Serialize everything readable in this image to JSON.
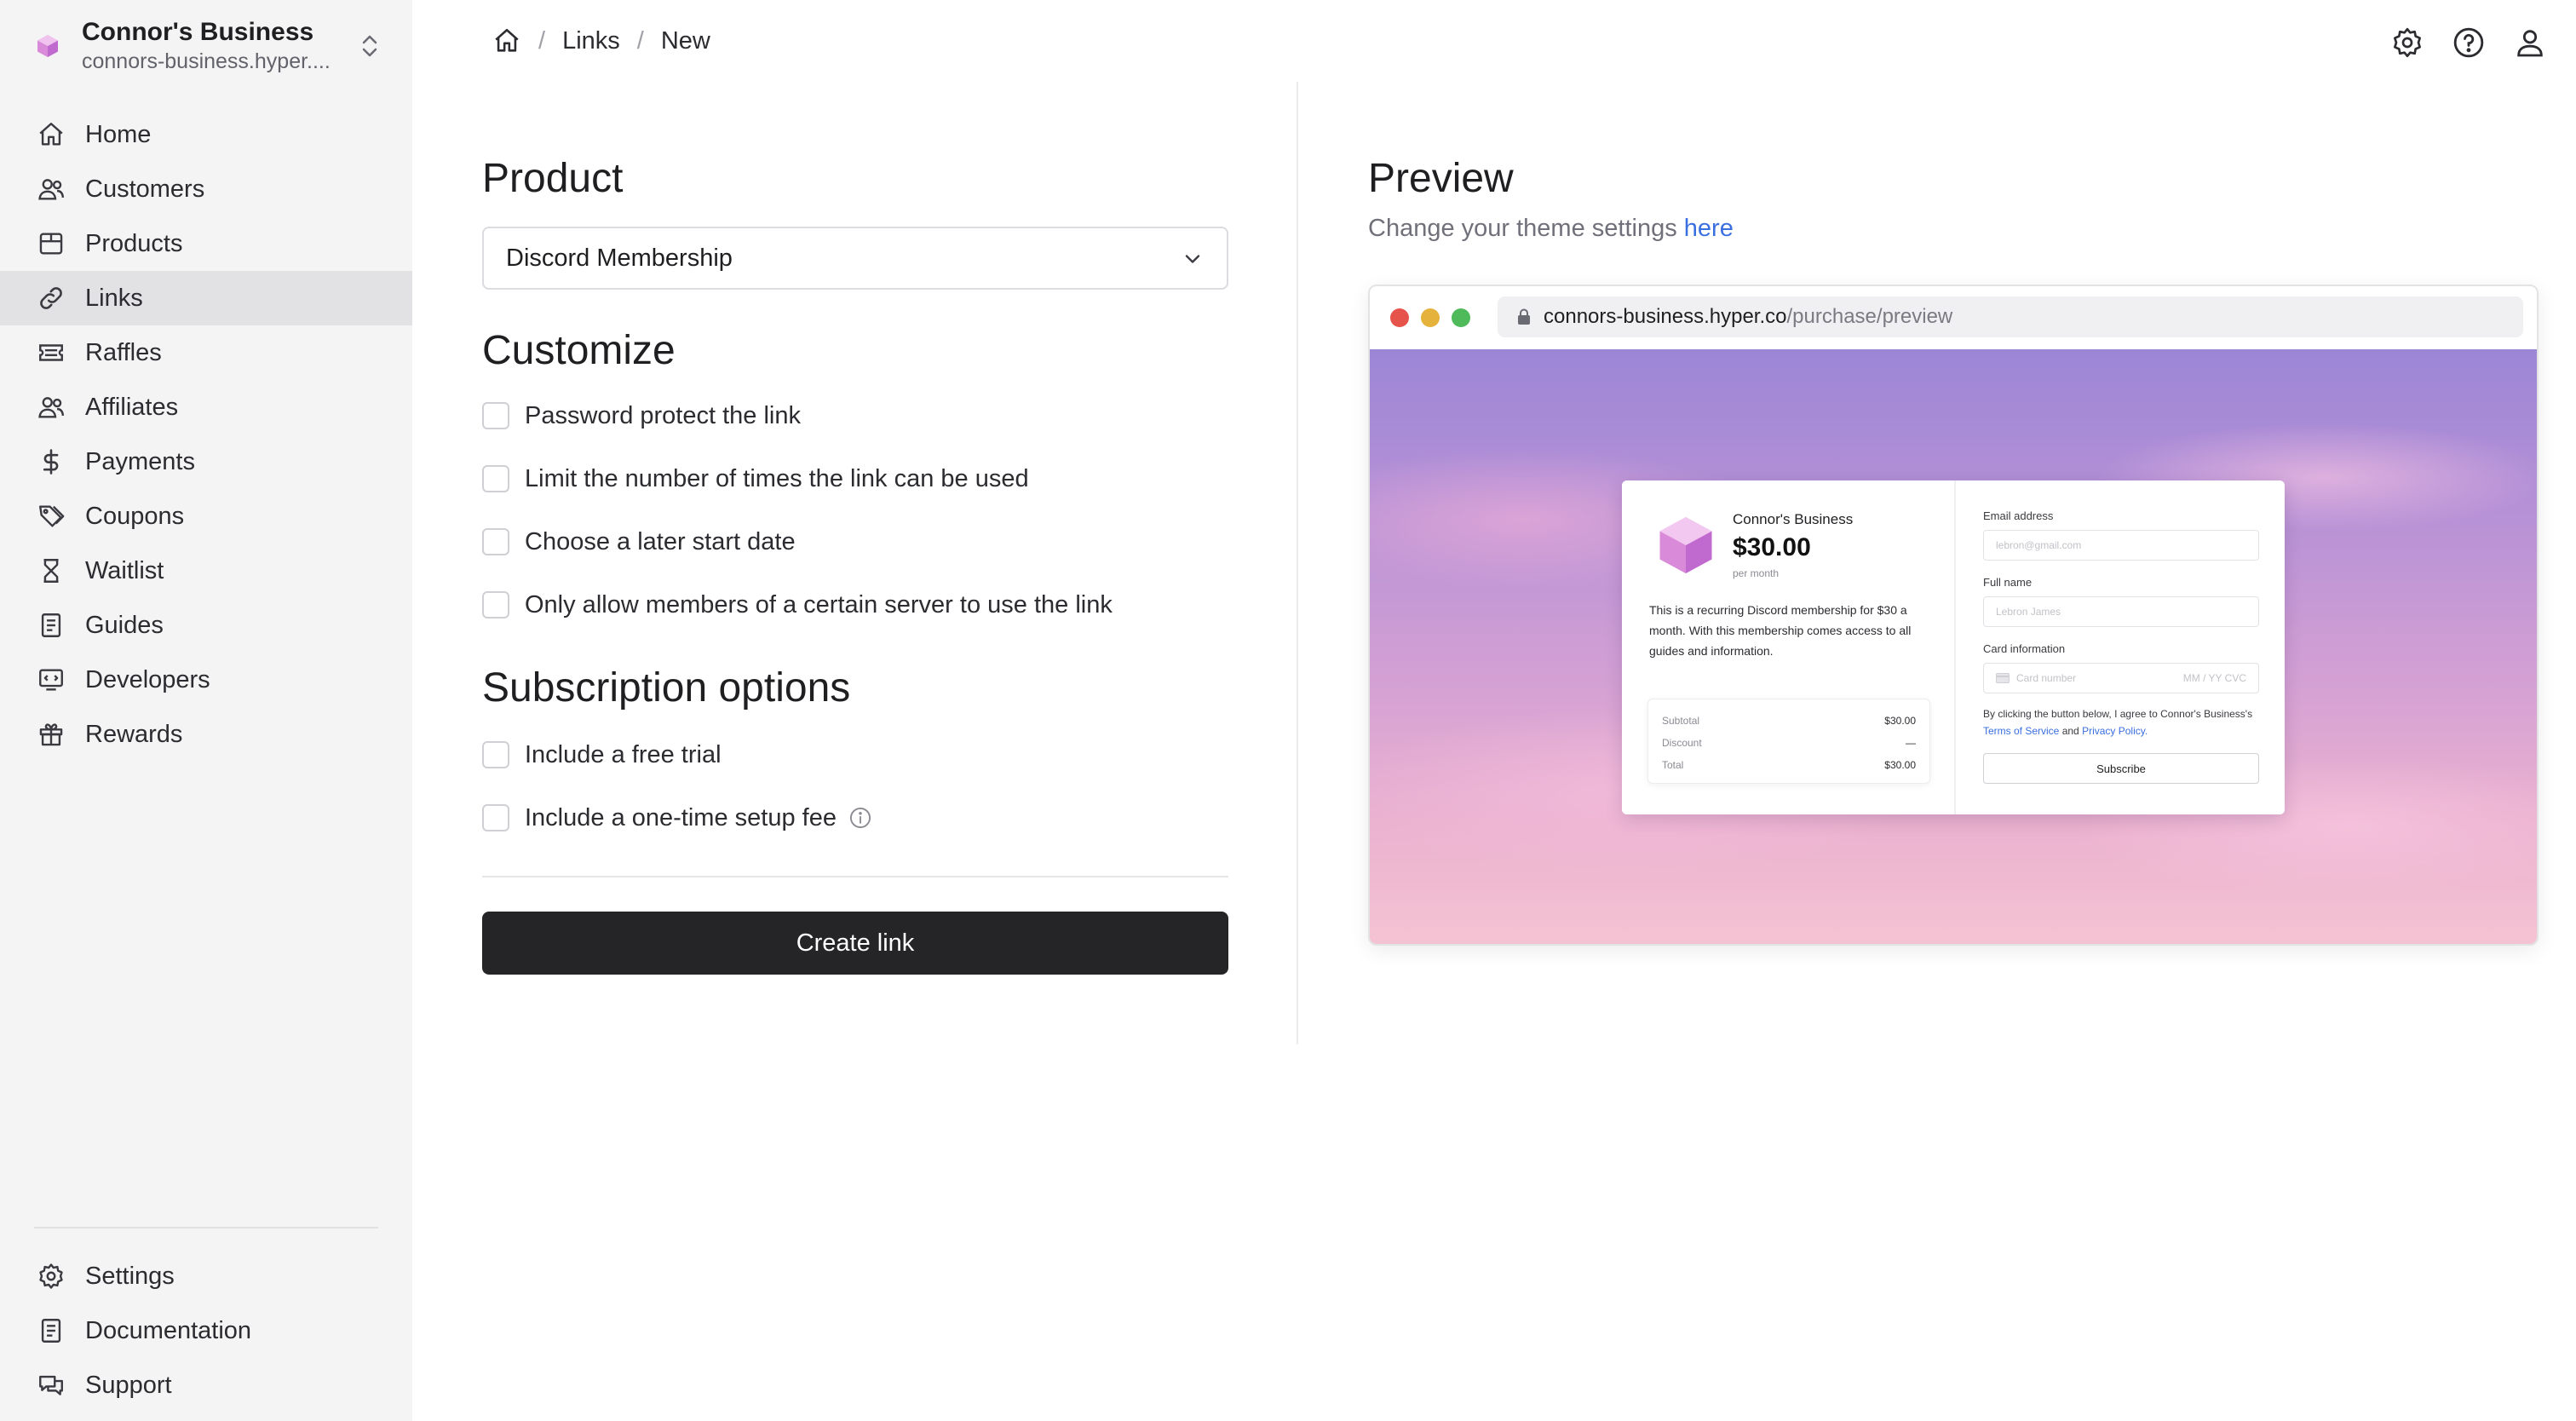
{
  "workspace": {
    "name": "Connor's Business",
    "domain": "connors-business.hyper...."
  },
  "sidebar": {
    "items": [
      {
        "label": "Home",
        "icon": "home-icon"
      },
      {
        "label": "Customers",
        "icon": "users-icon"
      },
      {
        "label": "Products",
        "icon": "box-icon"
      },
      {
        "label": "Links",
        "icon": "link-icon",
        "active": true
      },
      {
        "label": "Raffles",
        "icon": "ticket-icon"
      },
      {
        "label": "Affiliates",
        "icon": "users-icon"
      },
      {
        "label": "Payments",
        "icon": "dollar-icon"
      },
      {
        "label": "Coupons",
        "icon": "tag-icon"
      },
      {
        "label": "Waitlist",
        "icon": "hourglass-icon"
      },
      {
        "label": "Guides",
        "icon": "document-icon"
      },
      {
        "label": "Developers",
        "icon": "code-monitor-icon"
      },
      {
        "label": "Rewards",
        "icon": "gift-icon"
      }
    ],
    "bottom_items": [
      {
        "label": "Settings",
        "icon": "gear-icon"
      },
      {
        "label": "Documentation",
        "icon": "document-icon"
      },
      {
        "label": "Support",
        "icon": "chat-icon"
      }
    ]
  },
  "breadcrumb": {
    "home_icon": "home-icon",
    "items": [
      "Links",
      "New"
    ],
    "separator": "/"
  },
  "top_icons": [
    "gear-icon",
    "help-circle-icon",
    "user-icon"
  ],
  "form": {
    "product_title": "Product",
    "product_select_value": "Discord Membership",
    "customize_title": "Customize",
    "customize_options": [
      "Password protect the link",
      "Limit the number of times the link can be used",
      "Choose a later start date",
      "Only allow members of a certain server to use the link"
    ],
    "subscription_title": "Subscription options",
    "subscription_options": [
      "Include a free trial",
      "Include a one-time setup fee"
    ],
    "create_button": "Create link"
  },
  "preview": {
    "title": "Preview",
    "subtitle": "Change your theme settings",
    "subtitle_link": "here",
    "url_host": "connors-business.hyper.co",
    "url_path": "/purchase/preview",
    "traffic_lights": [
      "#e5534b",
      "#e5b23b",
      "#4fba5a"
    ],
    "checkout": {
      "business": "Connor's Business",
      "price": "$30.00",
      "period": "per month",
      "description": "This is a recurring Discord membership for $30 a month. With this membership comes access to all guides and information.",
      "summary": [
        {
          "label": "Subtotal",
          "value": "$30.00"
        },
        {
          "label": "Discount",
          "value": "—"
        },
        {
          "label": "Total",
          "value": "$30.00"
        }
      ],
      "email_label": "Email address",
      "email_placeholder": "lebron@gmail.com",
      "name_label": "Full name",
      "name_placeholder": "Lebron James",
      "card_label": "Card information",
      "card_placeholder": "Card number",
      "card_exp_placeholder": "MM / YY  CVC",
      "terms_prefix": "By clicking the button below, I agree to Connor's Business's",
      "terms_link": "Terms of Service",
      "terms_and": "and",
      "privacy_link": "Privacy Policy.",
      "subscribe": "Subscribe"
    }
  },
  "colors": {
    "sidebar_bg": "#f4f4f5",
    "active_item_bg": "#e2e2e4",
    "primary_button": "#252527",
    "link_blue": "#3a6fe0",
    "brand_logo": "#d07ad0"
  }
}
